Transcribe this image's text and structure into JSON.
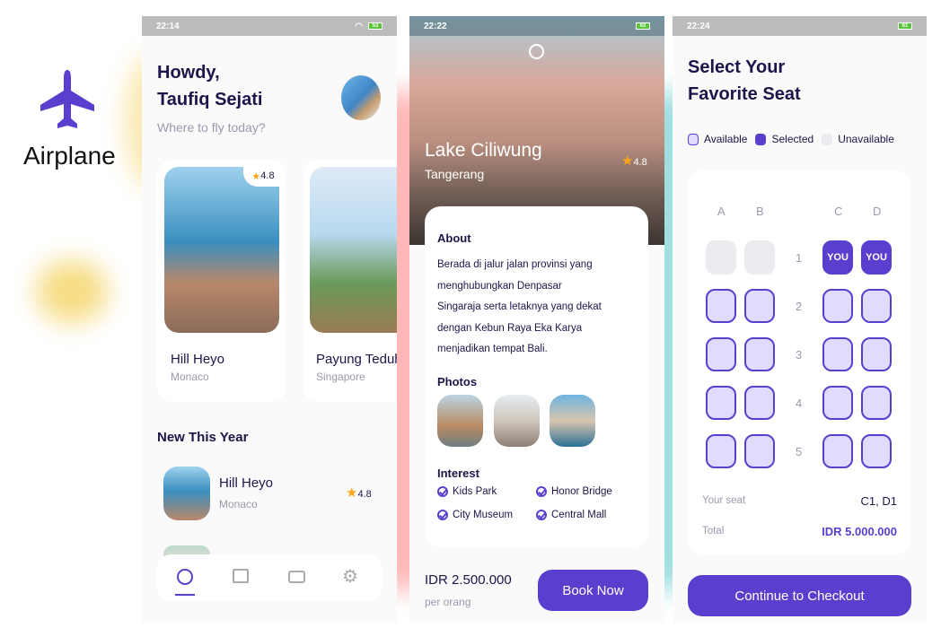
{
  "brand": {
    "name": "Airplane",
    "accent": "#5a3fcf"
  },
  "home": {
    "status_time": "22:14",
    "battery": "53",
    "greeting": "Howdy,",
    "user_name": "Taufiq Sejati",
    "subtitle": "Where to fly today?",
    "popular": [
      {
        "name": "Hill Heyo",
        "location": "Monaco",
        "rating": "4.8"
      },
      {
        "name": "Payung Teduh",
        "location": "Singapore"
      }
    ],
    "new_title": "New This Year",
    "new_items": [
      {
        "name": "Hill Heyo",
        "location": "Monaco",
        "rating": "4.8"
      }
    ],
    "nav": [
      "globe-icon",
      "book-icon",
      "card-icon",
      "gear-icon"
    ]
  },
  "detail": {
    "status_time": "22:22",
    "battery": "62",
    "name": "Lake Ciliwung",
    "location": "Tangerang",
    "rating": "4.8",
    "about_title": "About",
    "about_lines": [
      "Berada di jalur jalan provinsi yang",
      "menghubungkan Denpasar",
      "Singaraja serta letaknya yang dekat",
      "dengan Kebun Raya Eka Karya",
      "menjadikan tempat Bali."
    ],
    "photos_title": "Photos",
    "interest_title": "Interest",
    "interests": [
      "Kids Park",
      "Honor Bridge",
      "City Museum",
      "Central Mall"
    ],
    "price": "IDR 2.500.000",
    "price_unit": "per orang",
    "book_label": "Book Now"
  },
  "seat": {
    "status_time": "22:24",
    "battery": "61",
    "title_line1": "Select Your",
    "title_line2": "Favorite Seat",
    "legend": [
      "Available",
      "Selected",
      "Unavailable"
    ],
    "columns": [
      "A",
      "B",
      "C",
      "D"
    ],
    "rows": [
      "1",
      "2",
      "3",
      "4",
      "5"
    ],
    "you_label": "YOU",
    "your_seat_label": "Your seat",
    "your_seat_value": "C1, D1",
    "total_label": "Total",
    "total_value": "IDR 5.000.000",
    "checkout_label": "Continue to Checkout"
  }
}
